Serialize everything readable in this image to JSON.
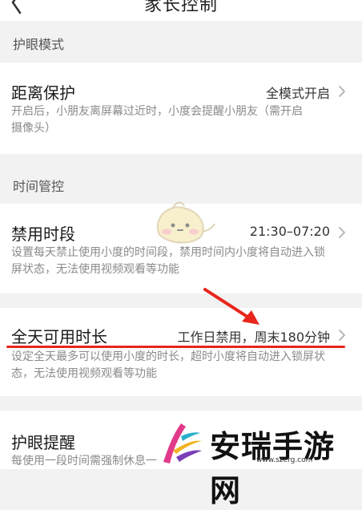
{
  "header": {
    "title": "家长控制"
  },
  "sections": {
    "eye": {
      "label": "护眼模式",
      "distance": {
        "title": "距离保护",
        "value": "全模式开启",
        "desc_line1": "开启后，小朋友离屏幕过近时，小度会提醒小朋友（需开启",
        "desc_line2": "摄像头）"
      }
    },
    "time": {
      "label": "时间管控",
      "forbidden": {
        "title": "禁用时段",
        "value": "21:30–07:20",
        "desc_line1": "设置每天禁止使用小度的时间段，禁用时间内小度将自动进入锁",
        "desc_line2": "屏状态，无法使用视频观看等功能"
      },
      "allday": {
        "title": "全天可用时长",
        "value": "工作日禁用，周末180分钟",
        "desc_line1": "设定全天最多可以使用小度的时长，超时小度将自动进入锁屏状",
        "desc_line2": "态，无法使用视频观看等功能"
      },
      "eyecare": {
        "title": "护眼提醒",
        "desc_line1": "每使用一段时间需强制休息一"
      }
    }
  },
  "watermark": {
    "text": "安瑞手游网",
    "url": "www.szerg.com"
  },
  "colors": {
    "accent_red": "#e8251c",
    "background": "#f2f2f2",
    "card": "#ffffff"
  }
}
